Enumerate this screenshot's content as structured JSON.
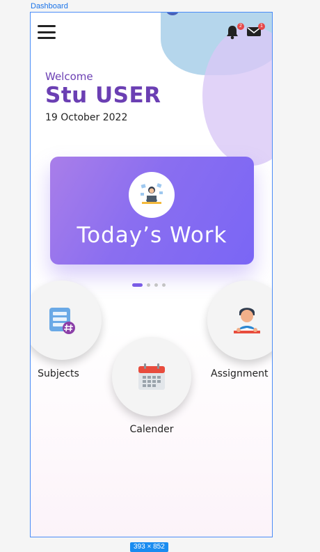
{
  "canvas": {
    "frame_label": "Dashboard",
    "size_label": "393 × 852"
  },
  "header": {
    "menu_icon": "hamburger-menu-icon",
    "notifications": {
      "icon": "bell-icon",
      "count": "2"
    },
    "messages": {
      "icon": "mail-icon",
      "count": "1"
    }
  },
  "greeting": {
    "welcome": "Welcome",
    "user_name": "Stu USER",
    "date": "19 October 2022"
  },
  "carousel": {
    "title": "Today’s Work",
    "icon": "person-at-desk-icon",
    "slides": 4,
    "active_index": 0
  },
  "modules": {
    "subjects": {
      "label": "Subjects",
      "icon": "subjects-icon"
    },
    "calendar": {
      "label": "Calender",
      "icon": "calendar-icon"
    },
    "assignments": {
      "label": "Assignment",
      "icon": "student-reading-icon"
    }
  },
  "colors": {
    "accent": "#6b3fb3",
    "card_start": "#a97ee9",
    "card_end": "#7a66f5",
    "frame_border": "#4a8cf7"
  }
}
